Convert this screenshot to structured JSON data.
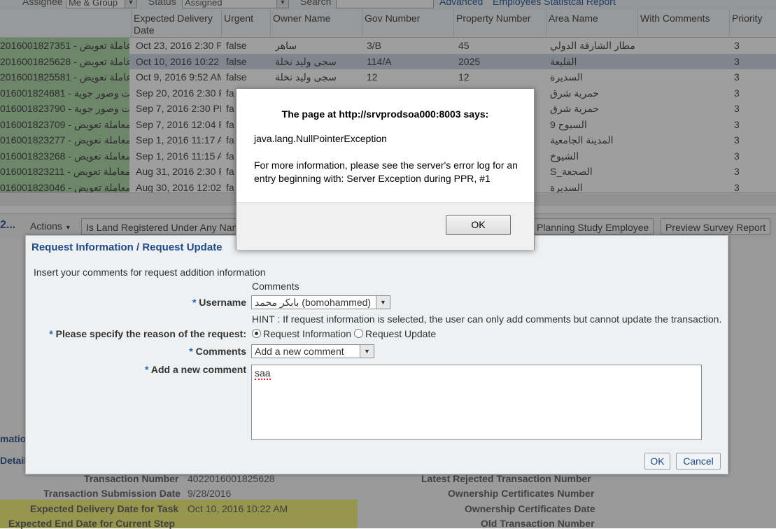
{
  "filter_bar": {
    "assignee_label": "Assignee",
    "assignee_value": "Me & Group",
    "status_label": "Status",
    "status_value": "Assigned",
    "search_label": "Search",
    "advanced_link": "Advanced",
    "report_link": "Employees Statistcal Report"
  },
  "table": {
    "columns": [
      "Expected Delivery Date",
      "Urgent",
      "Owner Name",
      "Gov Number",
      "Property Number",
      "Area Name",
      "With Comments",
      "Priority"
    ],
    "rows": [
      {
        "txn": "2016001827351 - عاملة تعويض",
        "date": "Oct 23, 2016 2:30 F",
        "urgent": "false",
        "owner": "ساهر",
        "gov": "3/B",
        "property": "45",
        "area": "مطار الشارقة الدولي",
        "comments": "",
        "priority": "3"
      },
      {
        "txn": "2016001825628 - عاملة تعويض",
        "date": "Oct 10, 2016 10:22",
        "urgent": "false",
        "owner": "سجى وليد نخلة",
        "gov": "114/A",
        "property": "2025",
        "area": "القليعة",
        "comments": "",
        "priority": "3"
      },
      {
        "txn": "2016001825581 - عاملة تعويض",
        "date": "Oct 9, 2016 9:52 AM",
        "urgent": "false",
        "owner": "سجى وليد نخلة",
        "gov": "12",
        "property": "12",
        "area": "السديرة",
        "comments": "",
        "priority": "3"
      },
      {
        "txn": "016001824681 - ات وصور جوية",
        "date": "Sep 20, 2016 2:30 F",
        "urgent": "fa",
        "owner": "",
        "gov": "",
        "property": "",
        "area": "حمرية شرق",
        "comments": "",
        "priority": "3"
      },
      {
        "txn": "016001823790 - ات وصور جوية",
        "date": "Sep 7, 2016 2:30 PM",
        "urgent": "fa",
        "owner": "",
        "gov": "",
        "property": "",
        "area": "حمرية شرق",
        "comments": "",
        "priority": "3"
      },
      {
        "txn": "016001823709 - معاملة تعويض",
        "date": "Sep 7, 2016 12:04 F",
        "urgent": "fa",
        "owner": "",
        "gov": "",
        "property": "",
        "area": "السيوح 9",
        "comments": "",
        "priority": "3"
      },
      {
        "txn": "016001823277 - معاملة تعويض",
        "date": "Sep 1, 2016 11:17 A",
        "urgent": "fa",
        "owner": "",
        "gov": "",
        "property": "",
        "area": "المدينة الجامعية",
        "comments": "",
        "priority": "3"
      },
      {
        "txn": "016001823268 - معاملة تعويض",
        "date": "Sep 1, 2016 11:15 A",
        "urgent": "fa",
        "owner": "",
        "gov": "",
        "property": "",
        "area": "الشيوخ",
        "comments": "",
        "priority": "3"
      },
      {
        "txn": "016001823211 - معاملة تعويض",
        "date": "Aug 31, 2016 2:30 F",
        "urgent": "fa",
        "owner": "",
        "gov": "",
        "property": "",
        "area": "الصجعة_S",
        "comments": "",
        "priority": "3"
      },
      {
        "txn": "016001823046 - معاملة تعويض",
        "date": "Aug 30, 2016 12:02",
        "urgent": "fa",
        "owner": "",
        "gov": "",
        "property": "",
        "area": "السديرة",
        "comments": "",
        "priority": "3"
      }
    ]
  },
  "toolbar2": {
    "number": "2...",
    "actions": "Actions",
    "land_registered": "Is Land Registered Under Any Nam",
    "planning_study": "Planning Study Employee",
    "preview_report": "Preview Survey Report"
  },
  "details": {
    "transaction_number_label": "Transaction Number",
    "transaction_number_value": "4022016001825628",
    "submission_date_label": "Transaction Submission Date",
    "submission_date_value": "9/28/2016",
    "expected_delivery_label": "Expected Delivery Date for Task",
    "expected_delivery_value": "Oct 10, 2016 10:22 AM",
    "expected_end_label": "Expected End Date for Current Step",
    "latest_rejected_label": "Latest Rejected Transaction Number",
    "ownership_certs_label": "Ownership Certificates Number",
    "ownership_date_label": "Ownership Certificates Date",
    "old_txn_label": "Old Transaction Number",
    "left_fragment_1": "mation",
    "left_fragment_2": "Detail"
  },
  "request_dialog": {
    "title": "Request Information / Request Update",
    "instruction": "Insert your comments for request addition information",
    "comments_heading": "Comments",
    "username_label": "Username",
    "username_value": "بابكر محمد (bomohammed)",
    "hint": "HINT : If request information is selected, the user can only add comments but cannot update the transaction.",
    "reason_label": "Please specify the reason of the request:",
    "reason_options": [
      "Request Information",
      "Request Update"
    ],
    "reason_selected": "Request Information",
    "comments_label": "Comments",
    "comments_value": "Add a new comment",
    "new_comment_label": "Add a new comment",
    "new_comment_value": "saa",
    "ok_label": "OK",
    "cancel_label": "Cancel",
    "required_mark": "*"
  },
  "alert": {
    "title": "The page at http://srvprodsoa000:8003 says:",
    "exception": "java.lang.NullPointerException",
    "message": "For more information, please see the server's error log for an entry beginning with: Server Exception during PPR, #1",
    "ok_label": "OK"
  }
}
